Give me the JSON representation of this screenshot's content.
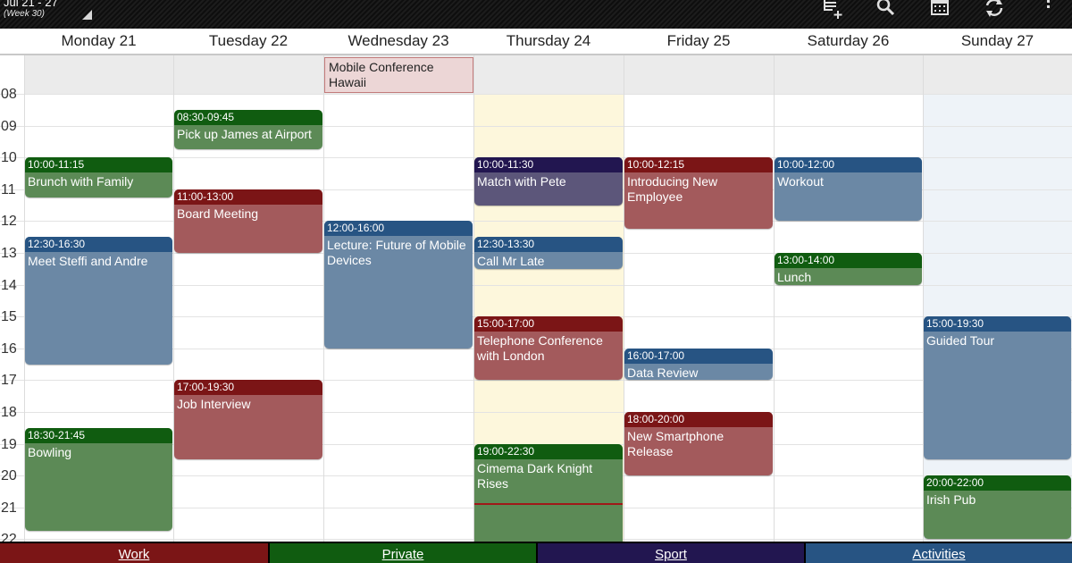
{
  "header": {
    "range": "Jul 21 - 27",
    "week": "(Week 30)"
  },
  "toolbar": {
    "icons": [
      "new-event-icon",
      "search-icon",
      "calendar-grid-icon",
      "sync-icon",
      "overflow-menu-icon"
    ]
  },
  "days": [
    {
      "label": "Monday 21"
    },
    {
      "label": "Tuesday 22"
    },
    {
      "label": "Wednesday 23"
    },
    {
      "label": "Thursday 24"
    },
    {
      "label": "Friday 25"
    },
    {
      "label": "Saturday 26"
    },
    {
      "label": "Sunday 27"
    }
  ],
  "hours": [
    "08",
    "09",
    "10",
    "11",
    "12",
    "13",
    "14",
    "15",
    "16",
    "17",
    "18",
    "19",
    "20",
    "21",
    "22"
  ],
  "allday": [
    {
      "day": 2,
      "title": "Mobile Conference Hawaii"
    }
  ],
  "events": [
    {
      "day": 0,
      "start": "10:00",
      "end": "11:15",
      "time": "10:00-11:15",
      "title": "Brunch with Family",
      "category": "private"
    },
    {
      "day": 0,
      "start": "12:30",
      "end": "16:30",
      "time": "12:30-16:30",
      "title": "Meet Steffi and Andre",
      "category": "activities"
    },
    {
      "day": 0,
      "start": "18:30",
      "end": "21:45",
      "time": "18:30-21:45",
      "title": "Bowling",
      "category": "private"
    },
    {
      "day": 1,
      "start": "08:30",
      "end": "09:45",
      "time": "08:30-09:45",
      "title": "Pick up James at Airport",
      "category": "private"
    },
    {
      "day": 1,
      "start": "11:00",
      "end": "13:00",
      "time": "11:00-13:00",
      "title": "Board Meeting",
      "category": "work"
    },
    {
      "day": 1,
      "start": "17:00",
      "end": "19:30",
      "time": "17:00-19:30",
      "title": "Job Interview",
      "category": "work"
    },
    {
      "day": 2,
      "start": "12:00",
      "end": "16:00",
      "time": "12:00-16:00",
      "title": "Lecture: Future of Mobile Devices",
      "category": "activities"
    },
    {
      "day": 3,
      "start": "10:00",
      "end": "11:30",
      "time": "10:00-11:30",
      "title": "Match with Pete",
      "category": "sport"
    },
    {
      "day": 3,
      "start": "12:30",
      "end": "13:30",
      "time": "12:30-13:30",
      "title": "Call Mr Late",
      "category": "activities"
    },
    {
      "day": 3,
      "start": "15:00",
      "end": "17:00",
      "time": "15:00-17:00",
      "title": "Telephone Conference with London",
      "category": "work"
    },
    {
      "day": 3,
      "start": "19:00",
      "end": "22:30",
      "time": "19:00-22:30",
      "title": "Cimema Dark Knight Rises",
      "category": "private"
    },
    {
      "day": 4,
      "start": "10:00",
      "end": "12:15",
      "time": "10:00-12:15",
      "title": "Introducing New Employee",
      "category": "work"
    },
    {
      "day": 4,
      "start": "16:00",
      "end": "17:00",
      "time": "16:00-17:00",
      "title": "Data Review",
      "category": "activities"
    },
    {
      "day": 4,
      "start": "18:00",
      "end": "20:00",
      "time": "18:00-20:00",
      "title": "New Smartphone Release",
      "category": "work"
    },
    {
      "day": 5,
      "start": "10:00",
      "end": "12:00",
      "time": "10:00-12:00",
      "title": "Workout",
      "category": "activities"
    },
    {
      "day": 5,
      "start": "13:00",
      "end": "14:00",
      "time": "13:00-14:00",
      "title": "Lunch",
      "category": "private"
    },
    {
      "day": 6,
      "start": "15:00",
      "end": "19:30",
      "time": "15:00-19:30",
      "title": "Guided Tour",
      "category": "activities"
    },
    {
      "day": 6,
      "start": "20:00",
      "end": "22:00",
      "time": "20:00-22:00",
      "title": "Irish Pub",
      "category": "private"
    }
  ],
  "today_index": 3,
  "weekend_highlight_index": 6,
  "now": "20:52",
  "legend": [
    {
      "label": "Work",
      "color": "#7b1516"
    },
    {
      "label": "Private",
      "color": "#105c10"
    },
    {
      "label": "Sport",
      "color": "#221650"
    },
    {
      "label": "Activities",
      "color": "#275483"
    }
  ],
  "colors": {
    "today_column": "#fdf7dc",
    "sunday_column": "#eef3f8",
    "allday_band": "#ebebeb"
  }
}
